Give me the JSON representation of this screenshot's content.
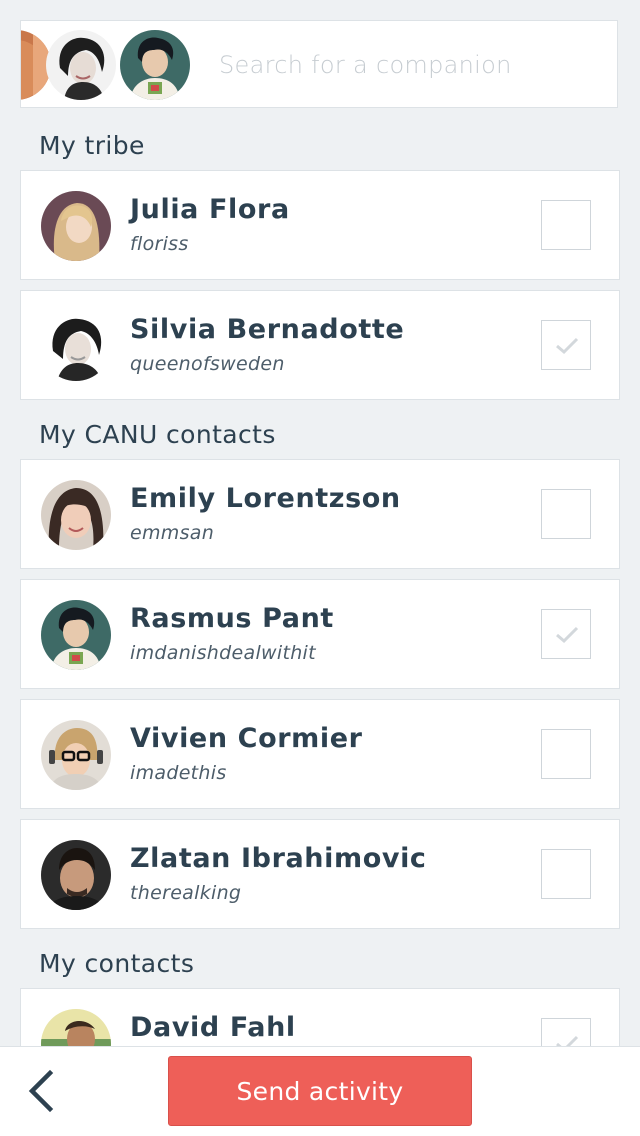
{
  "search": {
    "placeholder": "Search for a companion",
    "selected_avatars": [
      "partial-avatar",
      "silvia-bernadotte-avatar",
      "rasmus-pant-avatar"
    ]
  },
  "sections": [
    {
      "title": "My tribe"
    },
    {
      "title": "My CANU contacts"
    },
    {
      "title": "My contacts"
    }
  ],
  "tribe": [
    {
      "name": "Julia Flora",
      "handle": "floriss",
      "checked": false
    },
    {
      "name": "Silvia Bernadotte",
      "handle": "queenofsweden",
      "checked": true
    }
  ],
  "canu_contacts": [
    {
      "name": "Emily Lorentzson",
      "handle": "emmsan",
      "checked": false
    },
    {
      "name": "Rasmus Pant",
      "handle": "imdanishdealwithit",
      "checked": true
    },
    {
      "name": "Vivien Cormier",
      "handle": "imadethis",
      "checked": false
    },
    {
      "name": "Zlatan Ibrahimovic",
      "handle": "therealking",
      "checked": false
    }
  ],
  "contacts": [
    {
      "name": "David Fahl",
      "handle": "",
      "checked": true
    }
  ],
  "bottom_bar": {
    "back_icon": "chevron-left-icon",
    "send_label": "Send activity"
  },
  "colors": {
    "accent": "#ee5f58",
    "text": "#2d4150",
    "background": "#eef1f3"
  }
}
